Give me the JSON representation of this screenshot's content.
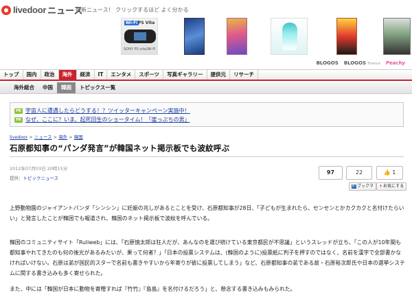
{
  "header": {
    "logo_text": "livedoor",
    "logo_news": "ニュース",
    "tagline": "最新ニュース！ クリックするほど よく分かる",
    "product1": {
      "wifi": "Wi-Fi",
      "vita": "PS Vita",
      "caption": "SONY PS vita/Wi-Fi"
    },
    "partners": {
      "blogos": "BLOGOS",
      "blogos_finance": "BLOGOS",
      "finance": "finance",
      "peachy": "Peachy"
    }
  },
  "nav": {
    "items": [
      "トップ",
      "国内",
      "政治",
      "海外",
      "経済",
      "IT",
      "エンタメ",
      "スポーツ",
      "写真ギャラリー",
      "提供元",
      "リサーチ"
    ],
    "active": "海外"
  },
  "subnav": {
    "items": [
      "海外総合",
      "中国",
      "韓国",
      "トピックス一覧"
    ],
    "active": "韓国"
  },
  "promo": {
    "badge": "PR",
    "links": [
      "宇宙人に遭遇したらどうする！？ツイッターキャンペーン実施中！",
      "なぜ、ここに？いま、起死回生のショータイム！「崖っぷちの男」"
    ]
  },
  "article": {
    "breadcrumb": [
      "livedoor",
      "ニュース",
      "海外",
      "韓国"
    ],
    "title": "石原都知事の“パンダ発言”が韓国ネット掲示板でも波紋呼ぶ",
    "date": "2012年07月03日 20時15分",
    "source_label": "提供：",
    "source_link": "トピックニュース",
    "counters": {
      "c1": "97",
      "c2": "22",
      "c3": "1"
    },
    "share": {
      "hatena": "B!",
      "hatena_label": "ブックマ",
      "plus": "+",
      "plus_label": "お気にする"
    },
    "paragraphs": [
      "上野動物園のジャイアントパンダ「シンシン」に妊娠の兆しがあるとことを受け、石原都知事が28日、「子どもが生まれたら、センセンとかカクカクと名付けたらいい」と発言したことが韓国でも報道され、韓国のネット掲示板で波紋を呼んでいる。",
      "韓国のコミュニティサイト「Ruliweb」には、「石原慎太郎は狂人だが、あんなのを選び続けている東京都民が不思議」というスレッドが立ち、「この人が10年間も都知事やれてきたのも何の後光があるみたいが、果って何者？」「日本の投票システムは、(韓国のように)投票紙に判子を押すのではなく、名前を漢字で全部書かなければいけない。石原は弟が国民的スターで名前も書きやすいから年寄りが彼に投票してしまう」など、石原都知事の弟である故・石原裕次郎氏や日本の選挙システムに関する書き込みも多く寄せられた。",
      "また、中には「韓国が日本に動物を寄贈すれば『竹竹』『島島』を名付けるだろう」と、懸念する書き込みもみられた。"
    ]
  }
}
